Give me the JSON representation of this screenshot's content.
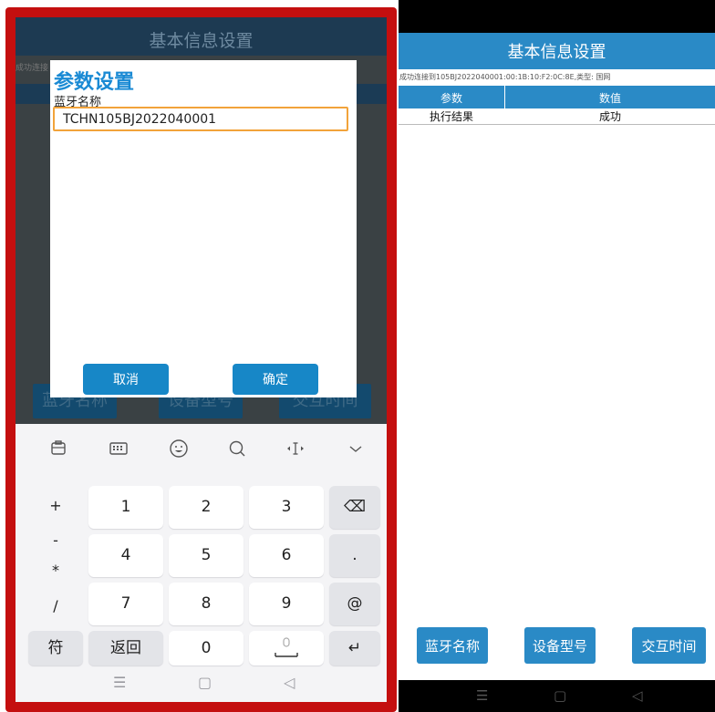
{
  "left": {
    "header_title": "基本信息设置",
    "status_text": "成功连接",
    "bg_buttons": [
      "蓝牙名称",
      "设备型号",
      "交互时间"
    ],
    "dialog": {
      "title": "参数设置",
      "field_label": "蓝牙名称",
      "field_value": "TCHN105BJ2022040001",
      "cancel_label": "取消",
      "confirm_label": "确定"
    },
    "keyboard": {
      "toolbar_icons": [
        "clipboard-icon",
        "keyboard-icon",
        "emoji-icon",
        "search-icon",
        "cursor-icon",
        "collapse-icon"
      ],
      "symbols": [
        "+",
        "-",
        "*",
        "/"
      ],
      "rows": [
        [
          "1",
          "2",
          "3"
        ],
        [
          "4",
          "5",
          "6"
        ],
        [
          "7",
          "8",
          "9"
        ]
      ],
      "row_right_keys": [
        "⌫",
        ".",
        "@"
      ],
      "bottom": {
        "symbols_key": "符",
        "back_key": "返回",
        "zero_key": "0",
        "enter_key": "↵"
      },
      "nav": [
        "☰",
        "▢",
        "◁"
      ]
    }
  },
  "right": {
    "header_title": "基本信息设置",
    "connection_status": "成功连接到105BJ2022040001:00:1B:10:F2:0C:8E,类型: 国网",
    "table": {
      "columns": [
        "参数",
        "数值"
      ],
      "rows": [
        {
          "param": "执行结果",
          "value": "成功"
        }
      ]
    },
    "buttons": [
      "蓝牙名称",
      "设备型号",
      "交互时间"
    ],
    "nav": [
      "☰",
      "▢",
      "◁"
    ]
  },
  "colors": {
    "accent_blue": "#2a8ac6",
    "frame_red": "#c40f0f",
    "input_focus": "#f2a33a"
  }
}
